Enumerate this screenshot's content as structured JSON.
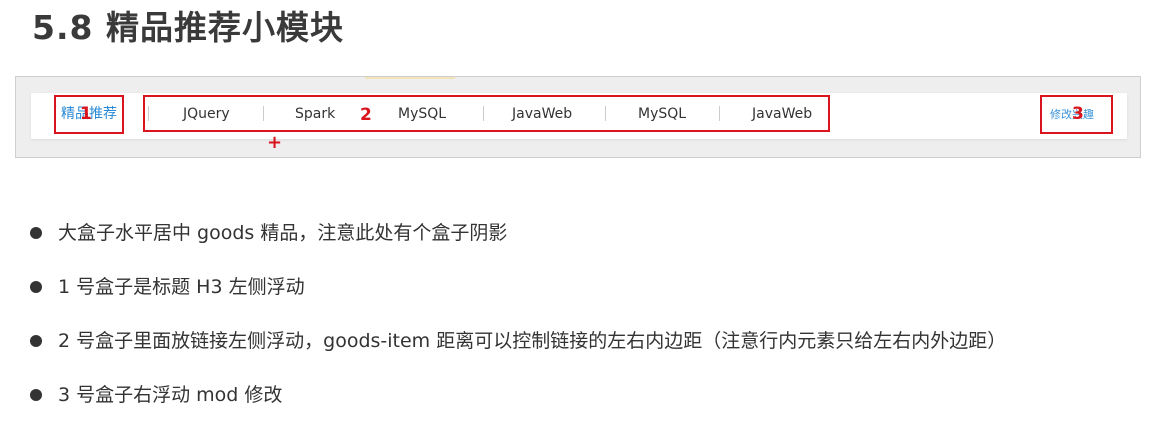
{
  "page_title": "5.8 精品推荐小模块",
  "goods": {
    "title": "精品推荐",
    "nav_links": [
      "JQuery",
      "Spark",
      "MySQL",
      "JavaWeb",
      "MySQL",
      "JavaWeb"
    ],
    "mod_link": "修改兴趣"
  },
  "annotations": {
    "box1": "1",
    "box2": "2",
    "box3": "3",
    "plus": "+"
  },
  "bullets": [
    "大盒子水平居中 goods 精品，注意此处有个盒子阴影",
    "1 号盒子是标题 H3 左侧浮动",
    "2 号盒子里面放链接左侧浮动，goods-item 距离可以控制链接的左右内边距（注意行内元素只给左右内外边距）",
    "3 号盒子右浮动 mod 修改"
  ],
  "colors": {
    "accent_red": "#d9141c",
    "link_blue": "#2a8ad6"
  }
}
